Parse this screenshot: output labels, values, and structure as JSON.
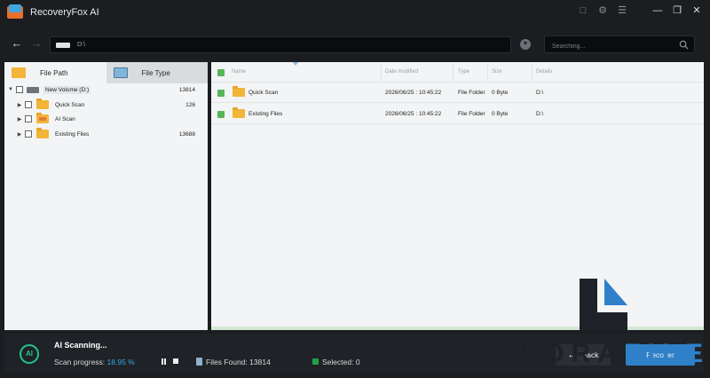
{
  "app": {
    "title": "RecoveryFox AI"
  },
  "titlebar": {
    "icons": [
      "feedback-icon",
      "settings-icon",
      "menu-icon",
      "minimize-icon",
      "restore-icon",
      "close-icon"
    ]
  },
  "toolbar": {
    "path": "D:\\",
    "search_placeholder": "Searching..."
  },
  "left_panel": {
    "tabs": [
      {
        "label": "File Path",
        "icon": "folder-icon",
        "active": true
      },
      {
        "label": "File Type",
        "icon": "image-file-icon",
        "active": false
      }
    ],
    "tree": [
      {
        "label": "New Volume (D:)",
        "count": "13814",
        "level": 0,
        "expanded": true,
        "icon": "hdd-icon"
      },
      {
        "label": "Quick Scan",
        "count": "126",
        "level": 1,
        "icon": "folder-icon"
      },
      {
        "label": "AI Scan",
        "count": "",
        "level": 1,
        "icon": "ai-folder-icon"
      },
      {
        "label": "Existing Files",
        "count": "13688",
        "level": 1,
        "icon": "folder-icon"
      }
    ]
  },
  "right_panel": {
    "columns": [
      "Name",
      "Date modified",
      "Type",
      "Size",
      "Details"
    ],
    "rows": [
      {
        "name": "Quick Scan",
        "date": "2026/06/25 : 10:45:22",
        "type": "File Folder",
        "size": "0 Byte",
        "details": "D:\\"
      },
      {
        "name": "Existing Files",
        "date": "2026/06/25 : 10:45:22",
        "type": "File Folder",
        "size": "0 Byte",
        "details": "D:\\"
      }
    ]
  },
  "status": {
    "ai_badge": "AI",
    "title": "AI Scanning...",
    "progress_label": "Scan progress:",
    "progress_value": "18.95 %",
    "files_found_label": "Files Found:",
    "files_found_value": "13814",
    "selected_label": "Selected:",
    "selected_value": "0",
    "back_label": "Back",
    "recover_label": "Recover"
  },
  "watermark": {
    "text_dark": "LORA",
    "text_blue": "FILE"
  },
  "colors": {
    "accent": "#2f80c8",
    "scan_green": "#24c48a",
    "progress_blue": "#39a7e6",
    "checkbox_green": "#56b556"
  }
}
